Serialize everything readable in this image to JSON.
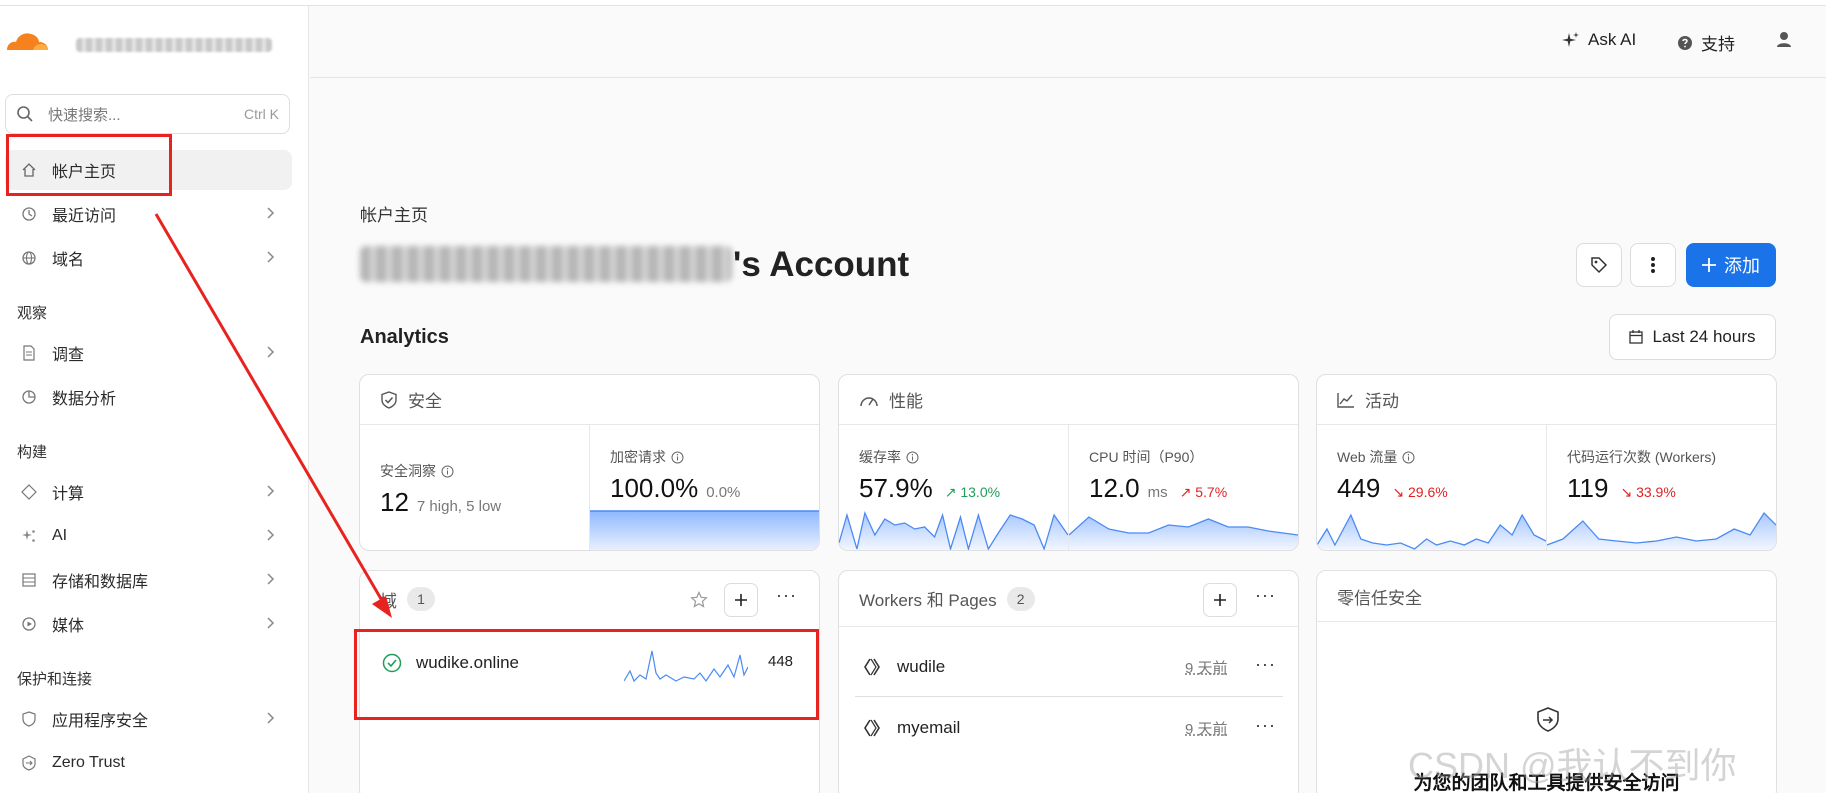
{
  "header": {
    "ask_ai": "Ask AI",
    "support": "支持"
  },
  "sidebar": {
    "search_placeholder": "快速搜索...",
    "search_shortcut": "Ctrl K",
    "items": [
      {
        "label": "帐户主页"
      },
      {
        "label": "最近访问"
      },
      {
        "label": "域名"
      },
      {
        "label": "调查"
      },
      {
        "label": "数据分析"
      },
      {
        "label": "计算"
      },
      {
        "label": "AI"
      },
      {
        "label": "存储和数据库"
      },
      {
        "label": "媒体"
      },
      {
        "label": "应用程序安全"
      },
      {
        "label": "Zero Trust"
      }
    ],
    "sections": {
      "observe": "观察",
      "build": "构建",
      "protect": "保护和连接"
    }
  },
  "main": {
    "breadcrumb": "帐户主页",
    "title_suffix": "'s Account",
    "add_label": "添加",
    "analytics_heading": "Analytics",
    "time_range": "Last 24 hours",
    "security": {
      "title": "安全",
      "insights_label": "安全洞察",
      "insights_value": "12",
      "insights_sub": "7 high, 5 low",
      "encrypted_label": "加密请求",
      "encrypted_value": "100.0%",
      "encrypted_change": "0.0%"
    },
    "performance": {
      "title": "性能",
      "cache_label": "缓存率",
      "cache_value": "57.9%",
      "cache_change": "↗ 13.0%",
      "cpu_label": "CPU 时间（P90）",
      "cpu_value": "12.0",
      "cpu_unit": "ms",
      "cpu_change": "↗ 5.7%"
    },
    "activity": {
      "title": "活动",
      "web_label": "Web 流量",
      "web_value": "449",
      "web_change": "↘ 29.6%",
      "workers_label": "代码运行次数 (Workers)",
      "workers_value": "119",
      "workers_change": "↘ 33.9%"
    },
    "domains": {
      "title": "域",
      "count": "1",
      "rows": [
        {
          "name": "wudike.online",
          "value": "448"
        }
      ]
    },
    "workers": {
      "title": "Workers 和 Pages",
      "count": "2",
      "rows": [
        {
          "name": "wudile",
          "time": "9 天前"
        },
        {
          "name": "myemail",
          "time": "9 天前"
        }
      ]
    },
    "zero_trust": {
      "title": "零信任安全",
      "promo": "为您的团队和工具提供安全访问"
    }
  },
  "watermark": "CSDN @我认不到你",
  "colors": {
    "accent": "#1a73e8",
    "up": "#1e9e5a",
    "down": "#e02222",
    "annotation": "#e8231f"
  }
}
